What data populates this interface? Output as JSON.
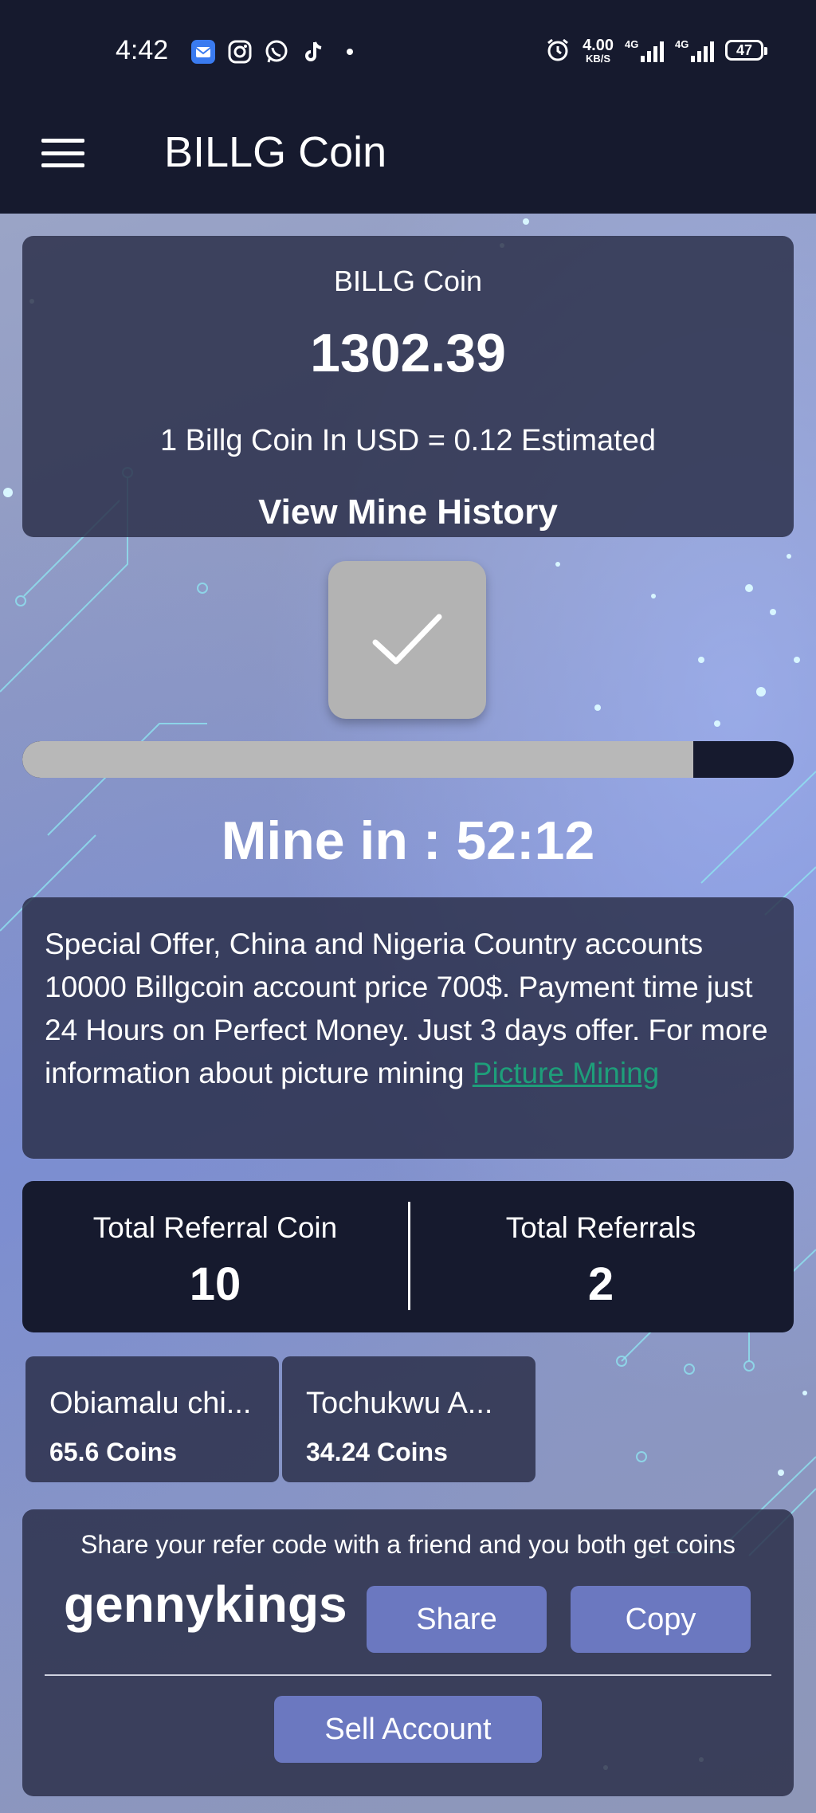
{
  "status_bar": {
    "time": "4:42",
    "net_speed_value": "4.00",
    "net_speed_unit": "KB/S",
    "signal1_label": "4G",
    "signal2_label": "4G",
    "battery": "47"
  },
  "app_bar": {
    "title": "BILLG Coin"
  },
  "balance": {
    "title": "BILLG Coin",
    "amount": "1302.39",
    "rate": "1 Billg Coin In USD = 0.12 Estimated",
    "history_label": "View Mine History"
  },
  "mining": {
    "progress_fraction": 0.87,
    "timer_label": "Mine in : 52:12"
  },
  "offer": {
    "text": "Special Offer, China and Nigeria Country accounts 10000 Billgcoin account price 700$. Payment time just 24 Hours on Perfect Money. Just 3 days offer. For more information about picture mining ",
    "link_text": "Picture Mining"
  },
  "referral_stats": {
    "coin_label": "Total Referral Coin",
    "coin_value": "10",
    "count_label": "Total Referrals",
    "count_value": "2"
  },
  "referrals": [
    {
      "name": "Obiamalu chi...",
      "coins": "65.6 Coins"
    },
    {
      "name": "Tochukwu A...",
      "coins": "34.24 Coins"
    }
  ],
  "share": {
    "message": "Share your refer code with a friend and you both get coins",
    "code": "gennykings",
    "share_label": "Share",
    "copy_label": "Copy",
    "sell_label": "Sell Account"
  },
  "colors": {
    "app_bar": "#161a2e",
    "button": "#6b78c0",
    "link": "#1e9e7a"
  }
}
